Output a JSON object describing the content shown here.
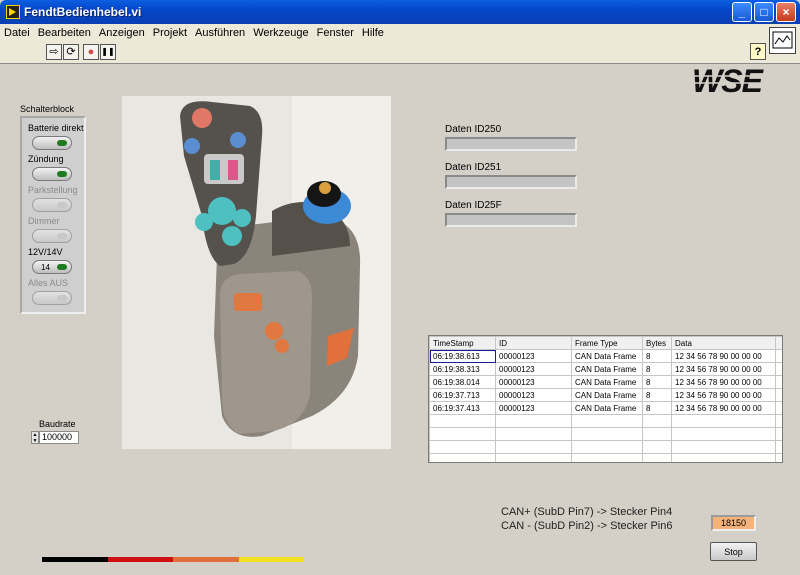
{
  "window": {
    "title": "FendtBedienhebel.vi",
    "minimize": "_",
    "maximize": "□",
    "close": "×"
  },
  "menu": [
    "Datei",
    "Bearbeiten",
    "Anzeigen",
    "Projekt",
    "Ausführen",
    "Werkzeuge",
    "Fenster",
    "Hilfe"
  ],
  "toolbar": {
    "run": "⇨",
    "run_continuous": "⟳",
    "abort": "●",
    "pause": "❚❚",
    "help": "?"
  },
  "logo": {
    "text": "WSE"
  },
  "schalterblock": {
    "title": "Schalterblock",
    "switches": [
      {
        "label": "Batterie direkt",
        "enabled": true,
        "led": "on"
      },
      {
        "label": "Zündung",
        "enabled": true,
        "led": "on"
      },
      {
        "label": "Parkstellung",
        "enabled": false,
        "led": "off"
      },
      {
        "label": "Dimmer",
        "enabled": false,
        "led": "off"
      },
      {
        "label": "12V/14V",
        "enabled": true,
        "led": "on",
        "value": "14"
      },
      {
        "label": "Alles AUS",
        "enabled": false,
        "led": "off"
      }
    ]
  },
  "fields": [
    {
      "label": "Daten ID250",
      "value": ""
    },
    {
      "label": "Daten ID251",
      "value": ""
    },
    {
      "label": "Daten ID25F",
      "value": ""
    }
  ],
  "table": {
    "headers": [
      "TimeStamp",
      "ID",
      "Frame Type",
      "Bytes",
      "Data",
      ""
    ],
    "rows": [
      [
        "06:19:38.613",
        "00000123",
        "CAN Data Frame",
        "8",
        "12 34 56 78 90 00 00 00",
        ""
      ],
      [
        "06:19:38.313",
        "00000123",
        "CAN Data Frame",
        "8",
        "12 34 56 78 90 00 00 00",
        ""
      ],
      [
        "06:19:38.014",
        "00000123",
        "CAN Data Frame",
        "8",
        "12 34 56 78 90 00 00 00",
        ""
      ],
      [
        "06:19:37.713",
        "00000123",
        "CAN Data Frame",
        "8",
        "12 34 56 78 90 00 00 00",
        ""
      ],
      [
        "06:19:37.413",
        "00000123",
        "CAN Data Frame",
        "8",
        "12 34 56 78 90 00 00 00",
        ""
      ],
      [
        "",
        "",
        "",
        "",
        "",
        ""
      ],
      [
        "",
        "",
        "",
        "",
        "",
        ""
      ],
      [
        "",
        "",
        "",
        "",
        "",
        ""
      ],
      [
        "",
        "",
        "",
        "",
        "",
        ""
      ]
    ]
  },
  "baudrate": {
    "label": "Baudrate",
    "value": "100000"
  },
  "wiring": [
    "CAN+ (SubD Pin7) -> Stecker Pin4",
    "CAN - (SubD Pin2) -> Stecker Pin6"
  ],
  "counter": "18150",
  "stop_label": "Stop",
  "colors": {
    "flag": [
      "#000000",
      "#d01010",
      "#e0703a",
      "#f0e020"
    ],
    "counter_bg": "#f5b27a",
    "panel_bg": "#d4d0c8"
  }
}
